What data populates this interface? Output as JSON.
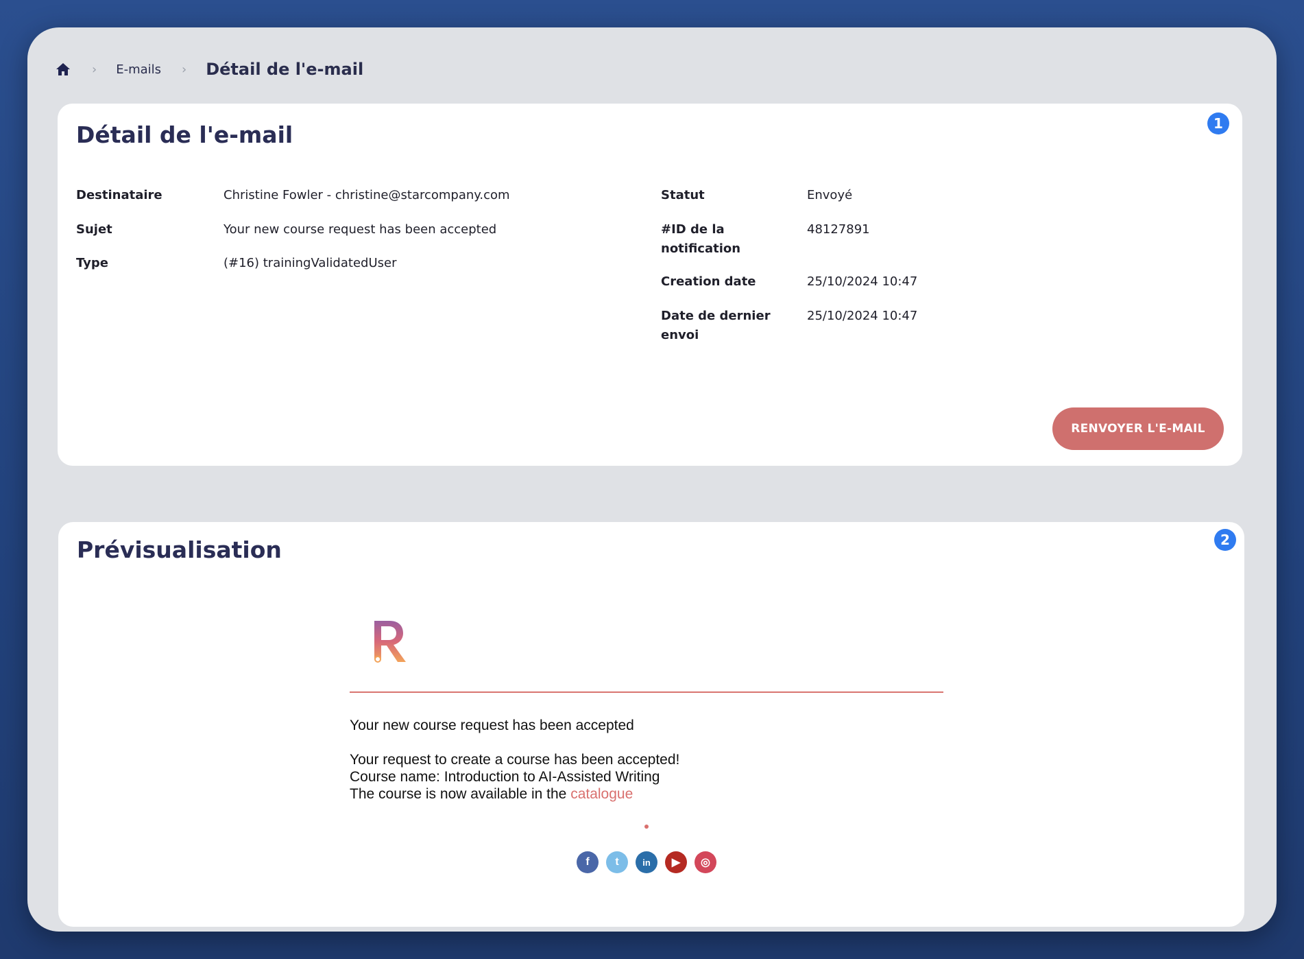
{
  "breadcrumb": {
    "home_icon": "home-icon",
    "items": [
      "E-mails"
    ],
    "current": "Détail de l'e-mail"
  },
  "detail": {
    "title": "Détail de l'e-mail",
    "badge": "1",
    "left_fields": [
      {
        "label": "Destinataire",
        "value": "Christine Fowler - christine@starcompany.com"
      },
      {
        "label": "Sujet",
        "value": "Your new course request has been accepted"
      },
      {
        "label": "Type",
        "value": "(#16) trainingValidatedUser"
      }
    ],
    "right_fields": [
      {
        "label": "Statut",
        "value": "Envoyé"
      },
      {
        "label": "#ID de la notification",
        "value": "48127891"
      },
      {
        "label": "Creation date",
        "value": "25/10/2024 10:47"
      },
      {
        "label": "Date de dernier envoi",
        "value": "25/10/2024 10:47"
      }
    ],
    "resend_button": "RENVOYER L'E-MAIL"
  },
  "preview": {
    "title": "Prévisualisation",
    "badge": "2",
    "email": {
      "logo": "R",
      "subject": "Your new course request has been accepted",
      "body_line1": "Your request to create a course has been accepted!",
      "body_line2": "Course name: Introduction to AI-Assisted Writing",
      "body_line3_prefix": "The course is now available in the",
      "body_link": "catalogue",
      "socials": [
        {
          "name": "facebook-icon",
          "glyph": "f",
          "color": "#4a67a8"
        },
        {
          "name": "twitter-icon",
          "glyph": "t",
          "color": "#7cbde8"
        },
        {
          "name": "linkedin-icon",
          "glyph": "in",
          "color": "#2b6ea9"
        },
        {
          "name": "youtube-icon",
          "glyph": "▶",
          "color": "#b52a22"
        },
        {
          "name": "instagram-icon",
          "glyph": "◎",
          "color": "#d3475a"
        }
      ]
    }
  },
  "colors": {
    "accent": "#cf706e",
    "badge": "#2f7bf0",
    "background": "#dfe1e5"
  }
}
